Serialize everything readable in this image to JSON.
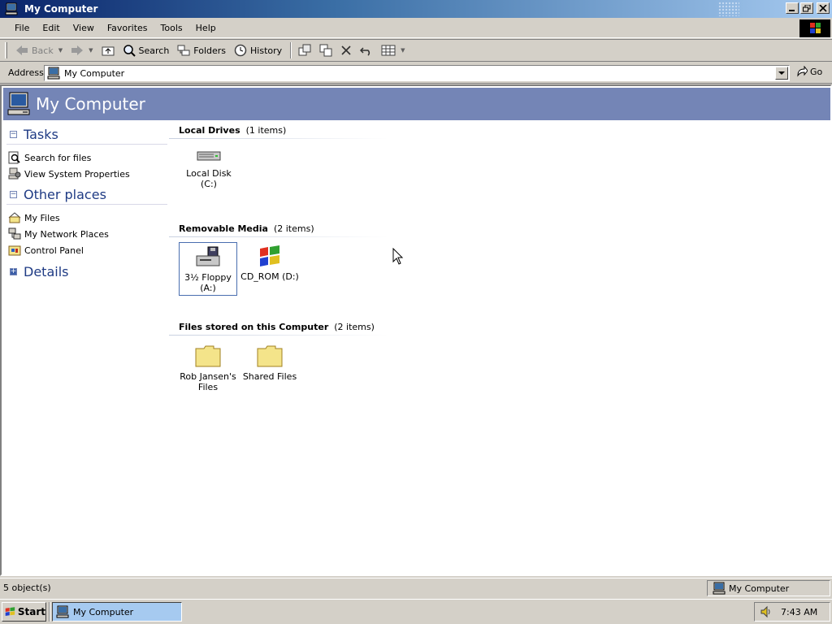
{
  "window": {
    "title": "My Computer"
  },
  "menu": {
    "items": [
      "File",
      "Edit",
      "View",
      "Favorites",
      "Tools",
      "Help"
    ]
  },
  "toolbar": {
    "back_label": "Back",
    "search_label": "Search",
    "folders_label": "Folders",
    "history_label": "History"
  },
  "address": {
    "label": "Address",
    "value": "My Computer",
    "go_label": "Go"
  },
  "header": {
    "title": "My Computer"
  },
  "left_pane": {
    "tasks": {
      "title": "Tasks",
      "toggle": "−",
      "links": [
        "Search for files",
        "View System Properties"
      ]
    },
    "other_places": {
      "title": "Other places",
      "toggle": "−",
      "links": [
        "My Files",
        "My Network Places",
        "Control Panel"
      ]
    },
    "details": {
      "title": "Details",
      "toggle": "+"
    }
  },
  "groups": {
    "local": {
      "title": "Local Drives",
      "count": "(1 items)",
      "items": [
        "Local Disk (C:)"
      ]
    },
    "removable": {
      "title": "Removable Media",
      "count": "(2 items)",
      "items": [
        "3½ Floppy (A:)",
        "CD_ROM (D:)"
      ]
    },
    "files": {
      "title": "Files stored on this Computer",
      "count": "(2 items)",
      "items": [
        "Rob Jansen's Files",
        "Shared Files"
      ]
    }
  },
  "status": {
    "left": "5 object(s)",
    "right": "My Computer"
  },
  "taskbar": {
    "start_label": "Start",
    "task_label": "My Computer",
    "clock": "7:43 AM"
  },
  "colors": {
    "header_band": "#7485b6",
    "title_blue": "#0a246a",
    "pane_title": "#1f3b84"
  }
}
